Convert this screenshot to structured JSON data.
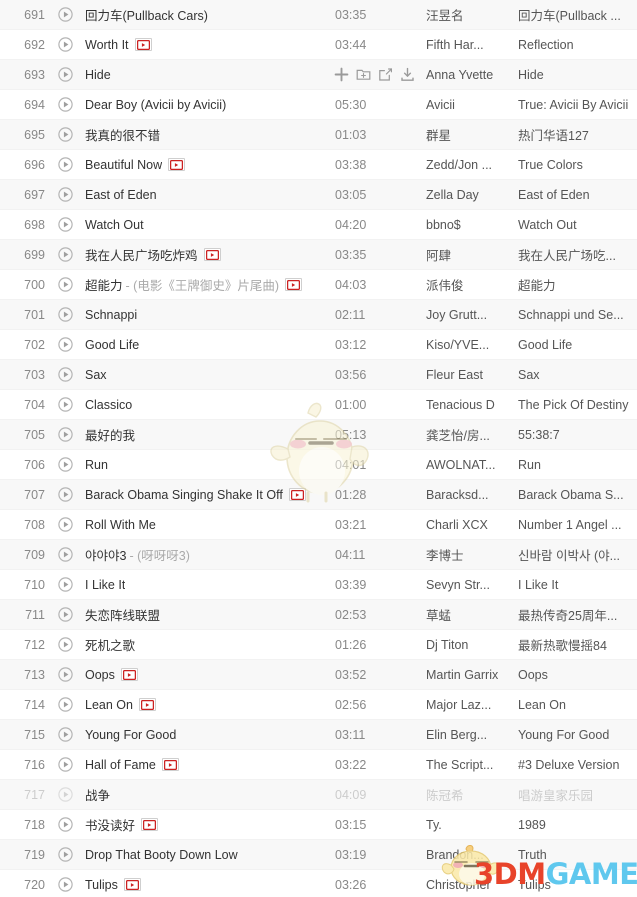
{
  "app": {
    "view_name": "playlist-track-list",
    "row_count": 30,
    "first_index": 691,
    "last_index": 720
  },
  "icons": {
    "play": "play-circle-icon",
    "mv": "mv-video-icon",
    "add": "add-plus-icon",
    "add_to_folder": "add-to-folder-icon",
    "share": "share-icon",
    "download": "download-icon"
  },
  "colors": {
    "row_alt_bg": "#f8f8f8",
    "row_bg": "#ffffff",
    "index_text": "#888888",
    "title_text": "#333333",
    "subtitle_text": "#aaaaaa",
    "meta_text": "#555555",
    "duration_text": "#888888",
    "disabled_text": "#cccccc",
    "mv_badge_red": "#cc2222",
    "brand_red": "#e8432a",
    "brand_blue": "#5fc8ee"
  },
  "watermark": {
    "brand_part1": "3DM",
    "brand_part2": "GAME",
    "mascot": "chick-mascot-watermark"
  },
  "hover_actions": {
    "row_index": 693,
    "labels": [
      "add",
      "add-to-folder",
      "share",
      "download"
    ]
  },
  "tracks": [
    {
      "index": "691",
      "title": "回力车(Pullback Cars)",
      "subtitle": "",
      "mv": false,
      "duration": "03:35",
      "artist": "汪昱名",
      "album": "回力车(Pullback ...",
      "disabled": false,
      "hover": false
    },
    {
      "index": "692",
      "title": "Worth It",
      "subtitle": "",
      "mv": true,
      "duration": "03:44",
      "artist": "Fifth Har...",
      "album": "Reflection",
      "disabled": false,
      "hover": false
    },
    {
      "index": "693",
      "title": "Hide",
      "subtitle": "",
      "mv": false,
      "duration": "",
      "artist": "Anna Yvette",
      "album": "Hide",
      "disabled": false,
      "hover": true
    },
    {
      "index": "694",
      "title": "Dear Boy (Avicii by Avicii)",
      "subtitle": "",
      "mv": false,
      "duration": "05:30",
      "artist": "Avicii",
      "album": "True: Avicii By Avicii",
      "disabled": false,
      "hover": false
    },
    {
      "index": "695",
      "title": "我真的很不错",
      "subtitle": "",
      "mv": false,
      "duration": "01:03",
      "artist": "群星",
      "album": "热门华语127",
      "disabled": false,
      "hover": false
    },
    {
      "index": "696",
      "title": "Beautiful Now",
      "subtitle": "",
      "mv": true,
      "duration": "03:38",
      "artist": "Zedd/Jon ...",
      "album": "True Colors",
      "disabled": false,
      "hover": false
    },
    {
      "index": "697",
      "title": "East of Eden",
      "subtitle": "",
      "mv": false,
      "duration": "03:05",
      "artist": "Zella Day",
      "album": "East of Eden",
      "disabled": false,
      "hover": false
    },
    {
      "index": "698",
      "title": "Watch Out",
      "subtitle": "",
      "mv": false,
      "duration": "04:20",
      "artist": "bbno$",
      "album": "Watch Out",
      "disabled": false,
      "hover": false
    },
    {
      "index": "699",
      "title": "我在人民广场吃炸鸡",
      "subtitle": "",
      "mv": true,
      "duration": "03:35",
      "artist": "阿肆",
      "album": "我在人民广场吃...",
      "disabled": false,
      "hover": false
    },
    {
      "index": "700",
      "title": "超能力",
      "subtitle": "- (电影《王牌御史》片尾曲)",
      "mv": true,
      "duration": "04:03",
      "artist": "派伟俊",
      "album": "超能力",
      "disabled": false,
      "hover": false
    },
    {
      "index": "701",
      "title": "Schnappi",
      "subtitle": "",
      "mv": false,
      "duration": "02:11",
      "artist": "Joy Grutt...",
      "album": "Schnappi und Se...",
      "disabled": false,
      "hover": false
    },
    {
      "index": "702",
      "title": "Good Life",
      "subtitle": "",
      "mv": false,
      "duration": "03:12",
      "artist": "Kiso/YVE...",
      "album": "Good Life",
      "disabled": false,
      "hover": false
    },
    {
      "index": "703",
      "title": "Sax",
      "subtitle": "",
      "mv": false,
      "duration": "03:56",
      "artist": "Fleur East",
      "album": "Sax",
      "disabled": false,
      "hover": false
    },
    {
      "index": "704",
      "title": "Classico",
      "subtitle": "",
      "mv": false,
      "duration": "01:00",
      "artist": "Tenacious D",
      "album": "The Pick Of Destiny",
      "disabled": false,
      "hover": false
    },
    {
      "index": "705",
      "title": "最好的我",
      "subtitle": "",
      "mv": false,
      "duration": "05:13",
      "artist": "龚芝怡/房...",
      "album": "55:38:7",
      "disabled": false,
      "hover": false
    },
    {
      "index": "706",
      "title": "Run",
      "subtitle": "",
      "mv": false,
      "duration": "04:01",
      "artist": "AWOLNAT...",
      "album": "Run",
      "disabled": false,
      "hover": false
    },
    {
      "index": "707",
      "title": "Barack Obama Singing Shake It Off",
      "subtitle": "",
      "mv": true,
      "duration": "01:28",
      "artist": "Baracksd...",
      "album": "Barack Obama S...",
      "disabled": false,
      "hover": false
    },
    {
      "index": "708",
      "title": "Roll With Me",
      "subtitle": "",
      "mv": false,
      "duration": "03:21",
      "artist": "Charli XCX",
      "album": "Number 1 Angel ...",
      "disabled": false,
      "hover": false
    },
    {
      "index": "709",
      "title": "야야야3",
      "subtitle": "- (呀呀呀3)",
      "mv": false,
      "duration": "04:11",
      "artist": "李博士",
      "album": "신바람 이박사 (야...",
      "disabled": false,
      "hover": false
    },
    {
      "index": "710",
      "title": "I Like It",
      "subtitle": "",
      "mv": false,
      "duration": "03:39",
      "artist": "Sevyn Str...",
      "album": "I Like It",
      "disabled": false,
      "hover": false
    },
    {
      "index": "711",
      "title": "失恋阵线联盟",
      "subtitle": "",
      "mv": false,
      "duration": "02:53",
      "artist": "草蜢",
      "album": "最热传奇25周年...",
      "disabled": false,
      "hover": false
    },
    {
      "index": "712",
      "title": "死机之歌",
      "subtitle": "",
      "mv": false,
      "duration": "01:26",
      "artist": "Dj Titon",
      "album": "最新热歌慢摇84",
      "disabled": false,
      "hover": false
    },
    {
      "index": "713",
      "title": "Oops",
      "subtitle": "",
      "mv": true,
      "duration": "03:52",
      "artist": "Martin Garrix",
      "album": "Oops",
      "disabled": false,
      "hover": false
    },
    {
      "index": "714",
      "title": "Lean On",
      "subtitle": "",
      "mv": true,
      "duration": "02:56",
      "artist": "Major Laz...",
      "album": "Lean On",
      "disabled": false,
      "hover": false
    },
    {
      "index": "715",
      "title": "Young For Good",
      "subtitle": "",
      "mv": false,
      "duration": "03:11",
      "artist": "Elin Berg...",
      "album": "Young For Good",
      "disabled": false,
      "hover": false
    },
    {
      "index": "716",
      "title": "Hall of Fame",
      "subtitle": "",
      "mv": true,
      "duration": "03:22",
      "artist": "The Script...",
      "album": "#3 Deluxe Version",
      "disabled": false,
      "hover": false
    },
    {
      "index": "717",
      "title": "战争",
      "subtitle": "",
      "mv": false,
      "duration": "04:09",
      "artist": "陈冠希",
      "album": "唱游皇家乐园",
      "disabled": true,
      "hover": false
    },
    {
      "index": "718",
      "title": "书没读好",
      "subtitle": "",
      "mv": true,
      "duration": "03:15",
      "artist": "Ty.",
      "album": "1989",
      "disabled": false,
      "hover": false
    },
    {
      "index": "719",
      "title": "Drop That Booty Down Low",
      "subtitle": "",
      "mv": false,
      "duration": "03:19",
      "artist": "Brandon...",
      "album": "Truth",
      "disabled": false,
      "hover": false
    },
    {
      "index": "720",
      "title": "Tulips",
      "subtitle": "",
      "mv": true,
      "duration": "03:26",
      "artist": "Christopher",
      "album": "Tulips",
      "disabled": false,
      "hover": false
    }
  ]
}
